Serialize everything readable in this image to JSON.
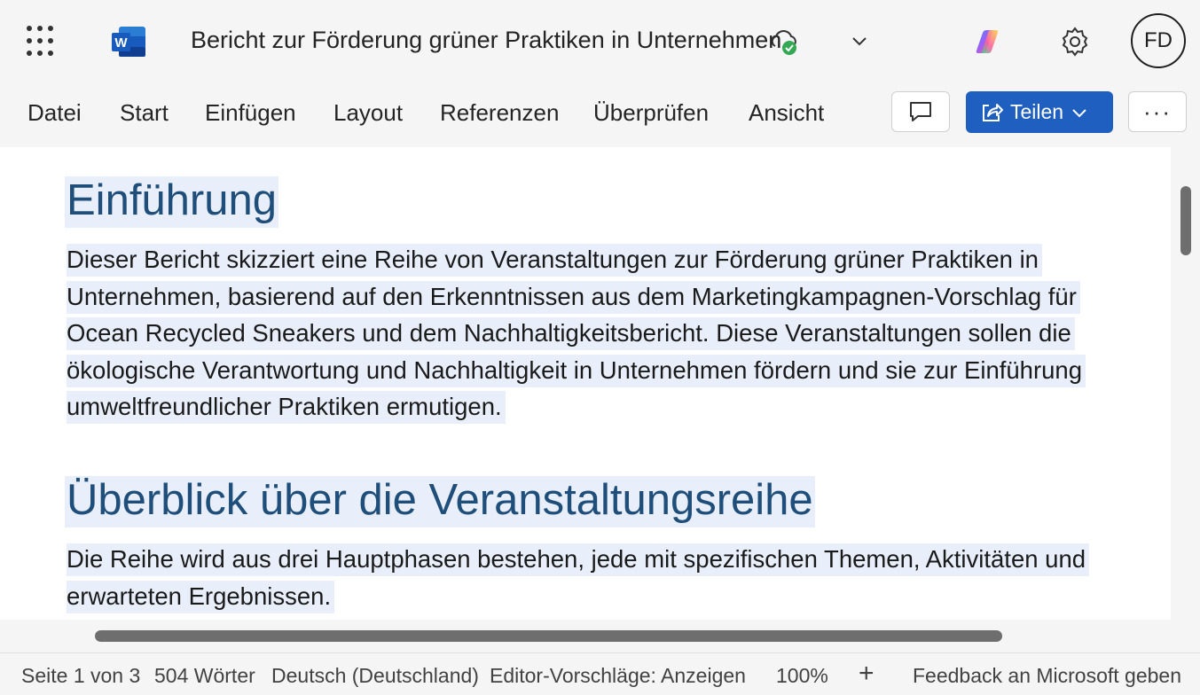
{
  "app": {
    "name": "Word",
    "accent": "#1f5fbf"
  },
  "titlebar": {
    "doc_title": "Bericht zur Förderung grüner Praktiken in Unternehmen",
    "avatar_initials": "FD"
  },
  "ribbon": {
    "tabs": [
      "Datei",
      "Start",
      "Einfügen",
      "Layout",
      "Referenzen",
      "Überprüfen",
      "Ansicht"
    ],
    "share_label": "Teilen",
    "more_label": "···"
  },
  "document": {
    "heading1": "Einführung",
    "para1_lines": [
      "Dieser Bericht skizziert eine Reihe von Veranstaltungen zur Förderung grüner Praktiken in",
      "Unternehmen, basierend auf den Erkenntnissen aus dem Marketingkampagnen-Vorschlag für",
      "Ocean Recycled Sneakers und dem Nachhaltigkeitsbericht. Diese Veranstaltungen sollen die",
      "ökologische Verantwortung und Nachhaltigkeit in Unternehmen fördern und sie zur Einführung",
      "umweltfreundlicher Praktiken ermutigen."
    ],
    "heading2": "Überblick über die Veranstaltungsreihe",
    "para2_lines": [
      "Die Reihe wird aus drei Hauptphasen bestehen, jede mit spezifischen Themen, Aktivitäten und",
      "erwarteten Ergebnissen."
    ]
  },
  "statusbar": {
    "page": "Seite 1 von 3",
    "words": "504 Wörter",
    "language": "Deutsch (Deutschland)",
    "editor": "Editor-Vorschläge: Anzeigen",
    "zoom": "100%",
    "zoom_in": "+",
    "feedback": "Feedback an Microsoft geben"
  }
}
